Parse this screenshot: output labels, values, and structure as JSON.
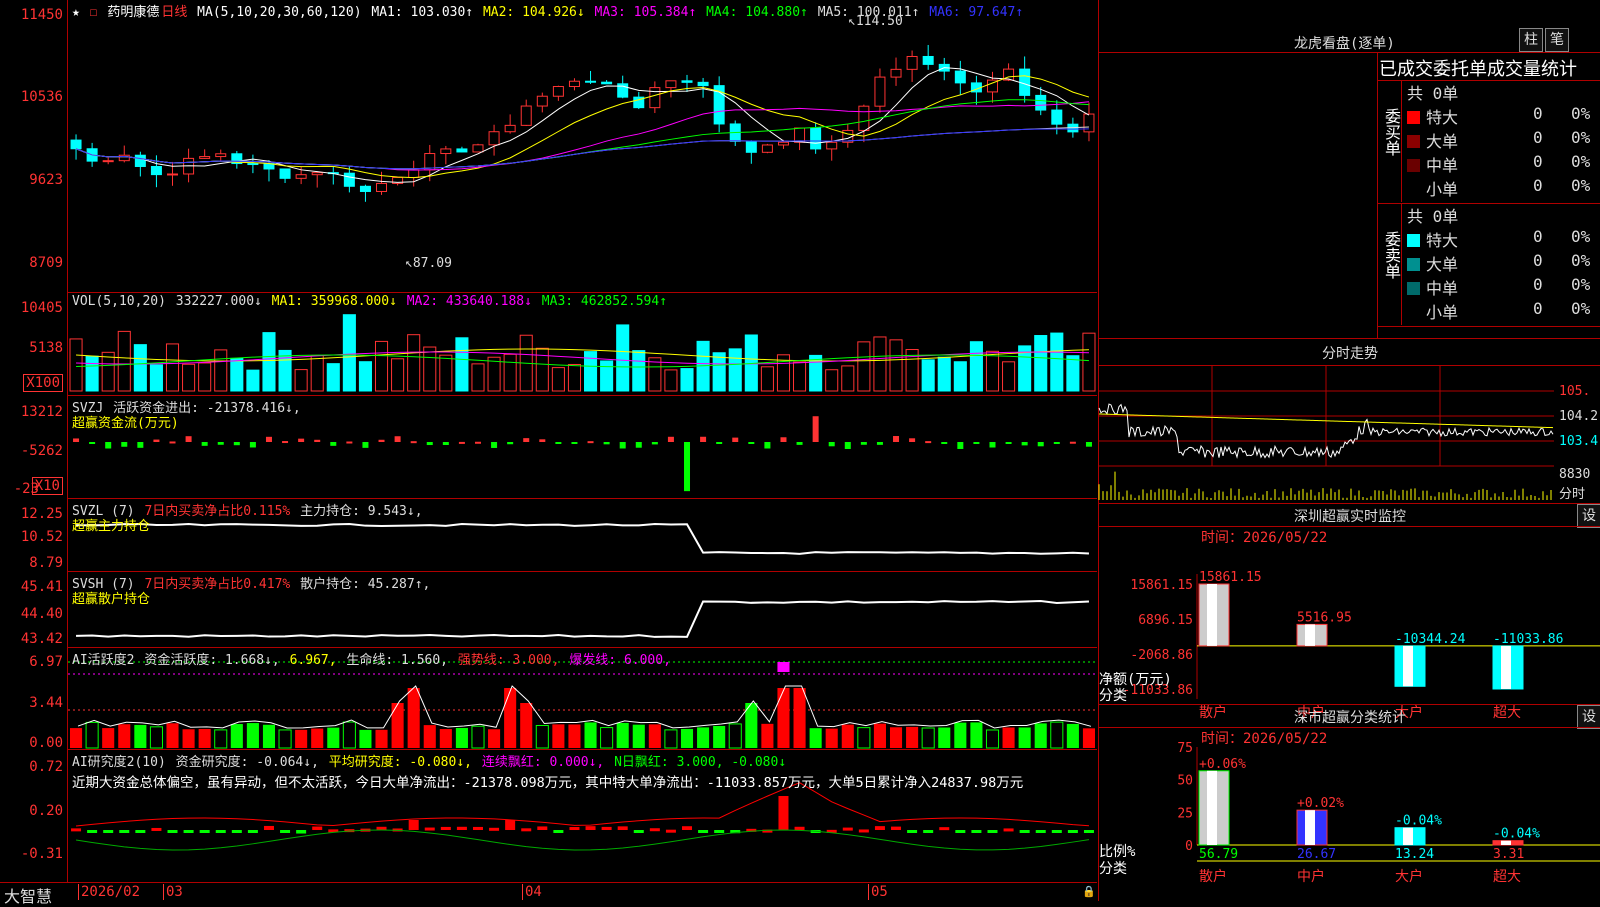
{
  "app_name": "大智慧",
  "stock": {
    "star": "★",
    "name": "药明康德",
    "period": "日线"
  },
  "ma_line": {
    "label": "MA(5,10,20,30,60,120)",
    "items": [
      {
        "text": "MA1: 103.030↑",
        "color": "#ffffff"
      },
      {
        "text": "MA2: 104.926↓",
        "color": "#ffff00"
      },
      {
        "text": "MA3: 105.384↑",
        "color": "#ff00ff"
      },
      {
        "text": "MA4: 104.880↑",
        "color": "#00ff00"
      },
      {
        "text": "MA5: 100.011↑",
        "color": "#dddddd"
      },
      {
        "text": "MA6: 97.647↑",
        "color": "#3333ff"
      }
    ]
  },
  "price_axis": [
    "11450",
    "10536",
    "9623",
    "8709"
  ],
  "price_annotations": {
    "high": "114.50",
    "low": "87.09"
  },
  "vol": {
    "label": "VOL(5,10,20)",
    "value": "332227.000↓",
    "items": [
      {
        "text": "MA1: 359968.000↓",
        "color": "#ffff00"
      },
      {
        "text": "MA2: 433640.188↓",
        "color": "#ff00ff"
      },
      {
        "text": "MA3: 462852.594↑",
        "color": "#00ff00"
      }
    ],
    "axis": [
      "10405",
      "5138"
    ],
    "unit": "X100"
  },
  "svzj": {
    "label": "SVZJ",
    "desc": "活跃资金进出: -21378.416↓,",
    "sub": "超赢资金流(万元)",
    "axis": [
      "13212",
      "-5262",
      "-23"
    ],
    "unit": "X10"
  },
  "svzl": {
    "label": "SVZL (7)",
    "ratio": "7日内买卖净占比0.115%",
    "hold": "主力持仓: 9.543↓,",
    "sub": "超赢主力持仓",
    "axis": [
      "12.25",
      "10.52",
      "8.79"
    ]
  },
  "svsh": {
    "label": "SVSH (7)",
    "ratio": "7日内买卖净占比0.417%",
    "hold": "散户持仓: 45.287↑,",
    "sub": "超赢散户持仓",
    "axis": [
      "45.41",
      "44.40",
      "43.42"
    ]
  },
  "ai_active": {
    "label": "AI活跃度2",
    "items": [
      {
        "text": "资金活跃度: 1.668↓,",
        "color": "#dddddd"
      },
      {
        "text": "6.967,",
        "color": "#ffff00"
      },
      {
        "text": "生命线: 1.560,",
        "color": "#dddddd"
      },
      {
        "text": "强势线: 3.000,",
        "color": "#ff3333"
      },
      {
        "text": "爆发线: 6.000,",
        "color": "#ff00ff"
      }
    ],
    "axis": [
      "6.97",
      "3.44",
      "0.00"
    ]
  },
  "ai_research": {
    "label": "AI研究度2(10)",
    "items": [
      {
        "text": "资金研究度: -0.064↓,",
        "color": "#dddddd"
      },
      {
        "text": "平均研究度: -0.080↓,",
        "color": "#ffff00"
      },
      {
        "text": "连续飘红: 0.000↓,",
        "color": "#ff00ff"
      },
      {
        "text": "N日飘红: 3.000, -0.080↓",
        "color": "#00ff00"
      }
    ],
    "comment": "近期大资金总体偏空，虽有异动，但不太活跃，今日大单净流出：-21378.098万元，其中特大单净流出：-11033.857万元，大单5日累计净入24837.98万元",
    "axis": [
      "0.72",
      "0.20",
      "-0.31"
    ]
  },
  "dates": {
    "start": "2026/02",
    "m3": "03",
    "m4": "04",
    "m5": "05"
  },
  "longhu": {
    "title": "龙虎看盘(逐单)",
    "btn1": "柱",
    "btn2": "笔",
    "header": "已成交委托单成交量统计",
    "buy": {
      "side": "委买单",
      "total": "共 0单",
      "rows": [
        {
          "name": "特大",
          "n": "0",
          "p": "0%",
          "color": "#ff0000"
        },
        {
          "name": "大单",
          "n": "0",
          "p": "0%",
          "color": "#8b0000"
        },
        {
          "name": "中单",
          "n": "0",
          "p": "0%",
          "color": "#6a0000"
        },
        {
          "name": "小单",
          "n": "0",
          "p": "0%",
          "color": "#000000"
        }
      ]
    },
    "sell": {
      "side": "委卖单",
      "total": "共 0单",
      "rows": [
        {
          "name": "特大",
          "n": "0",
          "p": "0%",
          "color": "#00ffff"
        },
        {
          "name": "大单",
          "n": "0",
          "p": "0%",
          "color": "#009090"
        },
        {
          "name": "中单",
          "n": "0",
          "p": "0%",
          "color": "#006a6a"
        },
        {
          "name": "小单",
          "n": "0",
          "p": "0%",
          "color": "#000000"
        }
      ]
    }
  },
  "intraday": {
    "title": "分时走势",
    "axis": [
      "105.",
      "104.2",
      "103.4",
      "8830",
      "分时"
    ]
  },
  "monitor": {
    "title": "深圳超赢实时监控",
    "btn": "设",
    "time": "时间：2026/05/22",
    "axis": [
      "15861.15",
      "6896.15",
      "-2068.86",
      "-11033.86"
    ],
    "net_label": "净额(万元)",
    "cat_label": "分类",
    "chart_data": {
      "type": "bar",
      "categories": [
        "散户",
        "中户",
        "大户",
        "超大"
      ],
      "values": [
        15861.15,
        5516.95,
        -10344.24,
        -11033.86
      ],
      "labels": [
        "15861.15",
        "5516.95",
        "-10344.24",
        "-11033.86"
      ],
      "ylim": [
        -11033.86,
        15861.15
      ]
    }
  },
  "classify": {
    "title": "深市超赢分类统计",
    "btn": "设",
    "time": "时间：2026/05/22",
    "axis": [
      "75",
      "50",
      "25",
      "0"
    ],
    "ratio_label": "比例%",
    "cat_label": "分类",
    "chart_data": {
      "type": "bar",
      "categories": [
        "散户",
        "中户",
        "大户",
        "超大"
      ],
      "values": [
        56.79,
        26.67,
        13.24,
        3.31
      ],
      "changes": [
        "+0.06%",
        "+0.02%",
        "-0.04%",
        "-0.04%"
      ],
      "value_labels": [
        "56.79",
        "26.67",
        "13.24",
        "3.31"
      ],
      "ylim": [
        0,
        75
      ]
    }
  },
  "colors": {
    "up": "#ff3333",
    "down": "#00ffff",
    "grid": "#b00000",
    "bg": "#000000"
  }
}
